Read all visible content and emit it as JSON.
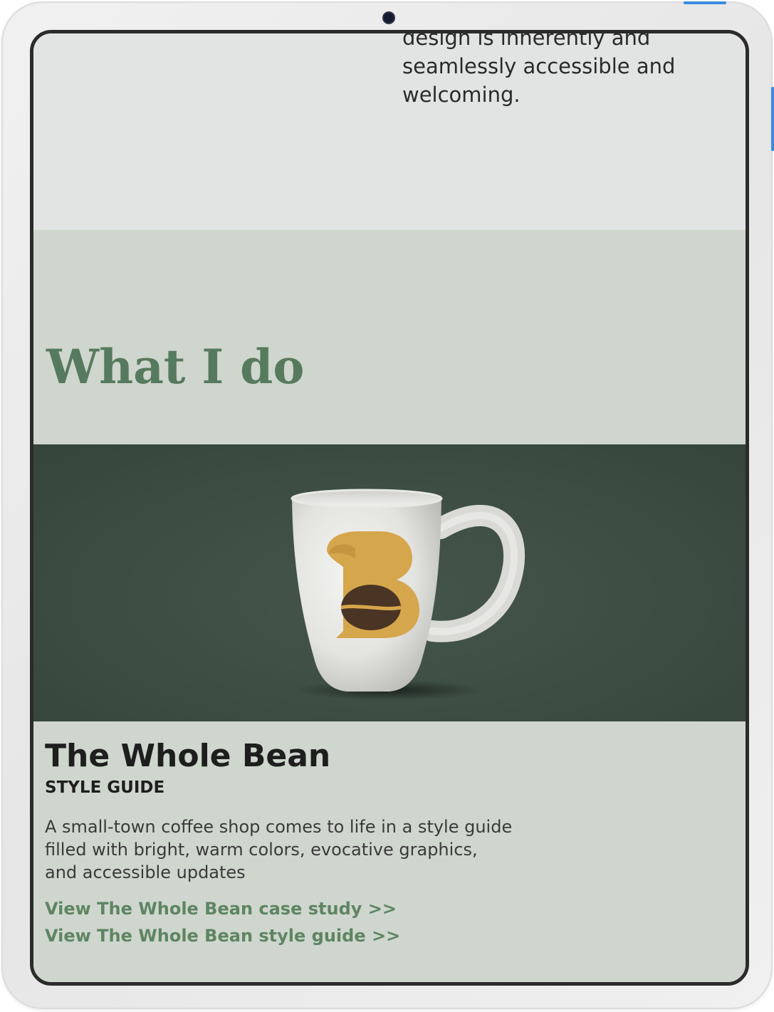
{
  "intro": {
    "text": "design is inherently and seamlessly accessible and welcoming."
  },
  "what_section": {
    "heading": "What I do"
  },
  "project": {
    "image_description": "White mug with The Whole Bean B logo",
    "logo_letter": "B",
    "title": "The Whole Bean",
    "subtitle": "STYLE GUIDE",
    "description": "A small-town coffee shop comes to life in a style guide filled with bright, warm colors, evocative graphics, and accessible updates",
    "links": {
      "case_study": "View The Whole Bean case study >>",
      "style_guide": "View The Whole Bean style guide >>"
    }
  },
  "colors": {
    "heading_green": "#567a5d",
    "link_green": "#5e8563",
    "section_bg": "#cfd6ce",
    "hero_bg": "#3d4d43",
    "logo_gold": "#d6a64c",
    "bean_brown": "#4a3524"
  }
}
